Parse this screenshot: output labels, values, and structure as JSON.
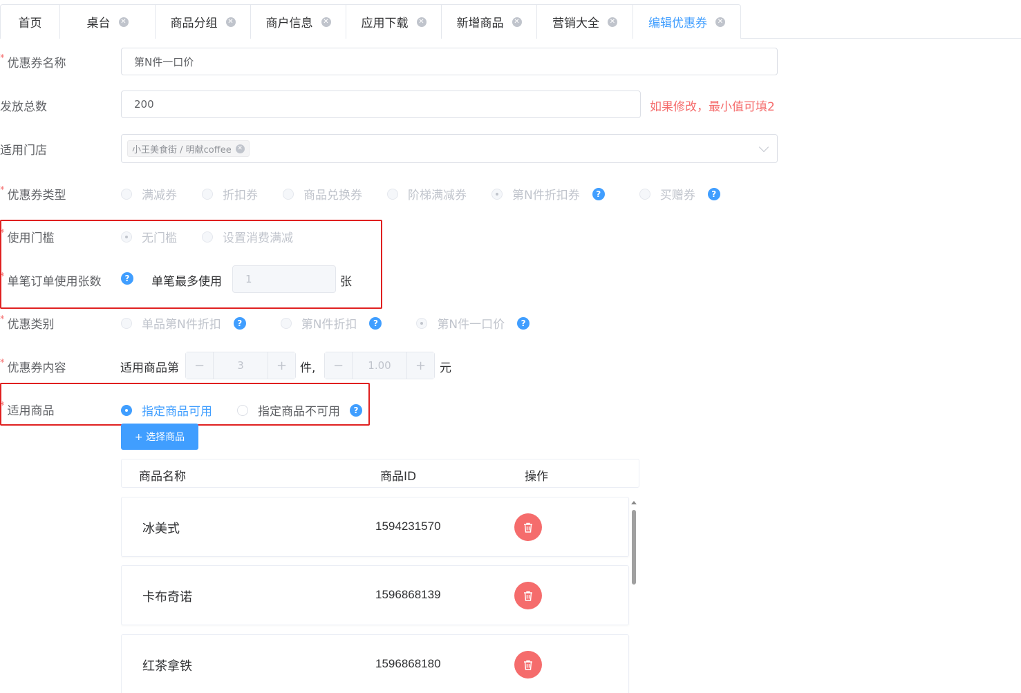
{
  "tabs": [
    {
      "label": "首页",
      "closable": false,
      "active": false
    },
    {
      "label": "桌台",
      "closable": true,
      "active": false
    },
    {
      "label": "商品分组",
      "closable": true,
      "active": false
    },
    {
      "label": "商户信息",
      "closable": true,
      "active": false
    },
    {
      "label": "应用下载",
      "closable": true,
      "active": false
    },
    {
      "label": "新增商品",
      "closable": true,
      "active": false
    },
    {
      "label": "营销大全",
      "closable": true,
      "active": false
    },
    {
      "label": "编辑优惠券",
      "closable": true,
      "active": true
    }
  ],
  "form": {
    "required_mark": "*",
    "coupon_name": {
      "label": "优惠券名称",
      "value": "第N件一口价"
    },
    "total": {
      "label": "发放总数",
      "value": "200",
      "hint": "如果修改，最小值可填2"
    },
    "stores": {
      "label": "适用门店",
      "tag": "小王美食街 / 明献coffee"
    },
    "coupon_type": {
      "label": "优惠券类型",
      "options": [
        "满减券",
        "折扣券",
        "商品兑换券",
        "阶梯满减券",
        "第N件折扣券",
        "买赠券"
      ],
      "selected": "第N件折扣券"
    },
    "threshold": {
      "label": "使用门槛",
      "options": [
        "无门槛",
        "设置消费满减"
      ],
      "selected": "无门槛"
    },
    "per_order": {
      "label": "单笔订单使用张数",
      "prefix": "单笔最多使用",
      "value": "1",
      "unit": "张"
    },
    "discount_kind": {
      "label": "优惠类别",
      "options": [
        "单品第N件折扣",
        "第N件折扣",
        "第N件一口价"
      ],
      "selected": "第N件一口价"
    },
    "content": {
      "label": "优惠券内容",
      "prefix": "适用商品第",
      "n_value": "3",
      "mid": "件,",
      "price_value": "1.00",
      "unit": "元"
    },
    "products": {
      "label": "适用商品",
      "options": [
        "指定商品可用",
        "指定商品不可用"
      ],
      "selected": "指定商品可用",
      "select_button": "+ 选择商品"
    }
  },
  "table": {
    "headers": {
      "name": "商品名称",
      "id": "商品ID",
      "action": "操作"
    },
    "rows": [
      {
        "name": "冰美式",
        "id": "1594231570"
      },
      {
        "name": "卡布奇诺",
        "id": "1596868139"
      },
      {
        "name": "红茶拿铁",
        "id": "1596868180"
      }
    ]
  },
  "icons": {
    "close": "close-icon",
    "help": "help-icon",
    "delete": "trash-icon",
    "dropdown": "chevron-down-icon"
  },
  "colors": {
    "primary": "#409eff",
    "danger": "#f56c6c",
    "highlight_box": "#e02020"
  }
}
